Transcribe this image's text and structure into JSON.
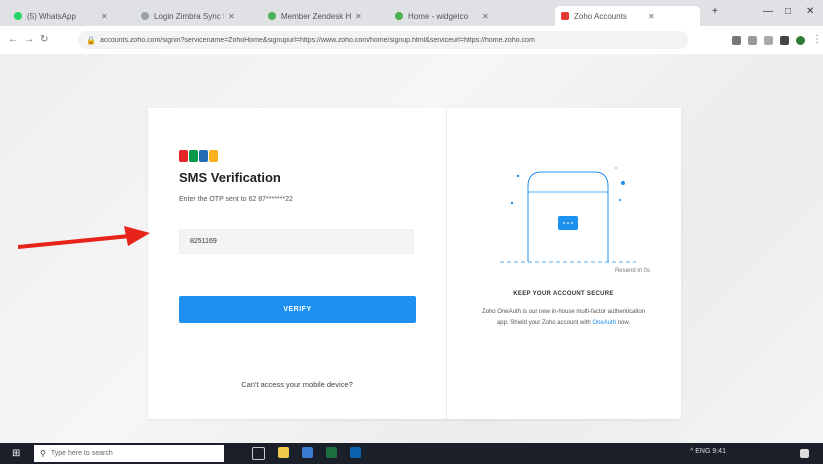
{
  "browser": {
    "tabs": [
      {
        "label": "(5) WhatsApp",
        "color": "#25d366"
      },
      {
        "label": "Login Zimbra Sync Signin",
        "color": "#9aa0a6"
      },
      {
        "label": "Member Zendesk Home",
        "color": "#4caf50"
      },
      {
        "label": "Home - widgetco",
        "color": "#4caf50"
      },
      {
        "label": "Zoho Accounts",
        "color": "#e53935",
        "active": true
      }
    ],
    "url": "accounts.zoho.com/signin?servicename=ZohoHome&signupurl=https://www.zoho.com/home/signup.html&serviceurl=https://home.zoho.com",
    "window_controls": [
      "—",
      "□",
      "✕"
    ]
  },
  "signin": {
    "logo_colors": [
      "#e42527",
      "#089949",
      "#226db4",
      "#f9b21d"
    ],
    "title": "SMS Verification",
    "subtitle": "Enter the OTP sent to 62 87*******22",
    "otp_value": "8251169",
    "resend": "Resend in 0s",
    "verify_label": "VERIFY",
    "cant_access": "Can't access your mobile device?"
  },
  "secure": {
    "heading": "KEEP YOUR ACCOUNT SECURE",
    "text_before": "Zoho OneAuth is our new in-house multi-factor authentication app. Shield your Zoho account with",
    "link": "OneAuth",
    "text_after": "now."
  },
  "taskbar": {
    "search_placeholder": "Type here to search",
    "app_icons": [
      "task-view-icon",
      "file-explorer-icon",
      "store-icon",
      "excel-icon",
      "outlook-icon"
    ],
    "tray_text": "^ ENG 9:41"
  },
  "annotation": {
    "arrow_color": "#e8231a"
  }
}
